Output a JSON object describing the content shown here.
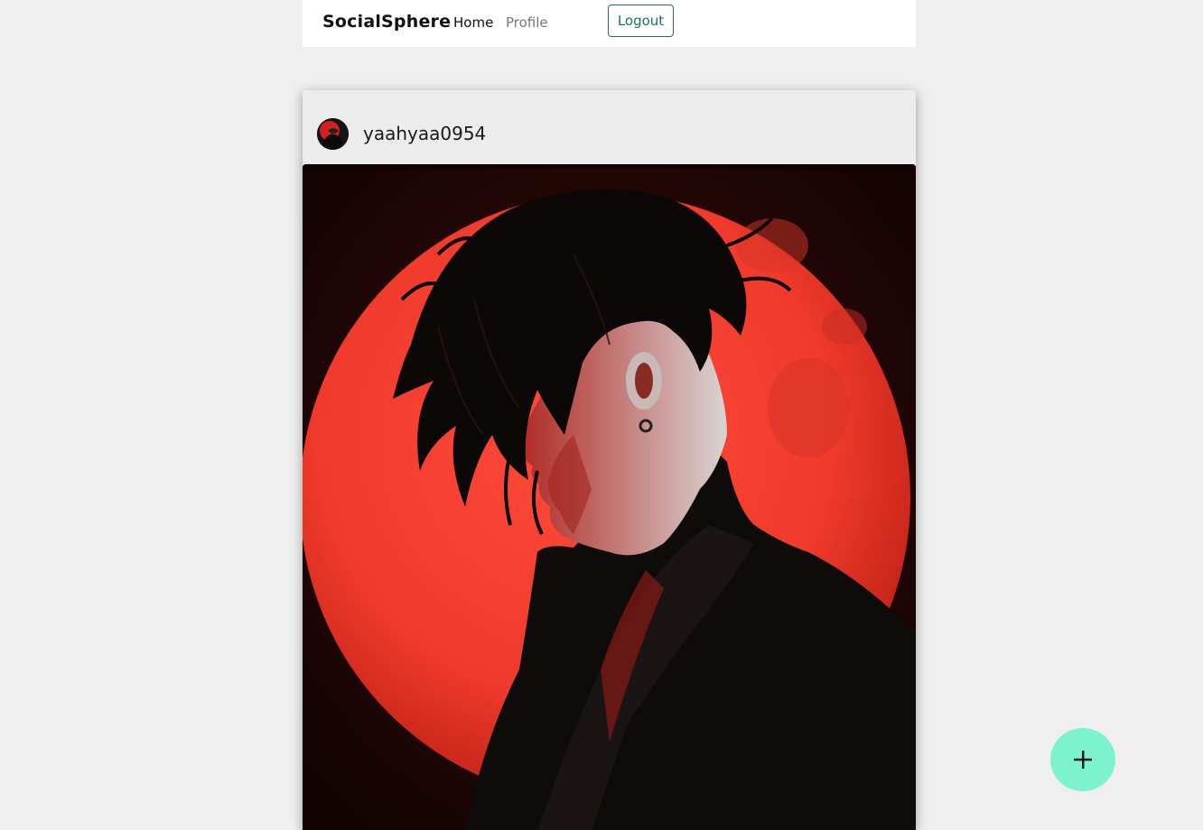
{
  "navbar": {
    "brand": "SocialSphere",
    "links": [
      {
        "label": "Home",
        "active": true
      },
      {
        "label": "Profile",
        "active": false
      }
    ],
    "logout_label": "Logout"
  },
  "post": {
    "username": "yaahyaa0954",
    "avatar_icon": "user-avatar-icon",
    "image_description_icon": "post-image"
  },
  "fab": {
    "icon": "plus-icon"
  },
  "colors": {
    "page_bg": "#efefef",
    "navbar_bg": "#ffffff",
    "accent": "#1f6f64",
    "fab_bg": "#7cf2cf",
    "card_bg": "#ececec"
  }
}
